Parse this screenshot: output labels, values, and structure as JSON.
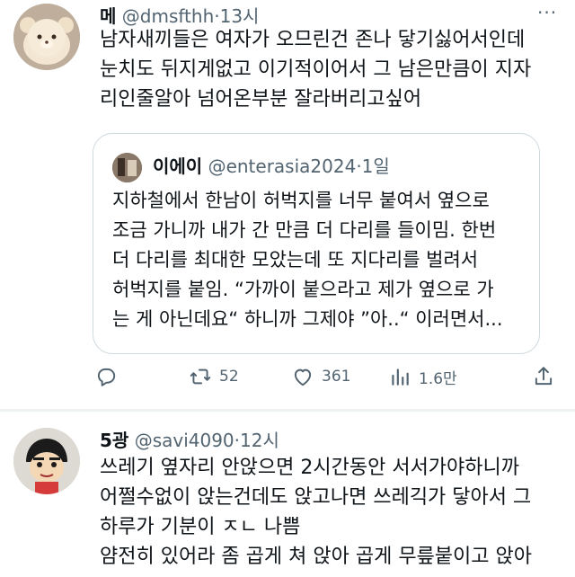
{
  "tweet1": {
    "name": "메",
    "handle": "@dmsfthh",
    "dot": "·",
    "time": "13시",
    "more": "···",
    "lines": [
      "남자새끼들은 여자가 오므린건 존나 닿기싫어서인데",
      "눈치도 뒤지게없고 이기적이어서 그 남은만큼이 지자",
      "리인줄알아 넘어온부분 잘라버리고싶어"
    ],
    "quote": {
      "name": "이에이",
      "handle": "@enterasia2024",
      "dot": "·",
      "time": "1일",
      "lines": [
        "지하철에서 한남이 허벅지를 너무 붙여서 옆으로",
        "조금 가니까 내가 간 만큼 더 다리를 들이밈. 한번",
        "더 다리를 최대한 모았는데 또 지다리를 벌려서",
        "허벅지를 붙임. “가까이 붙으라고 제가 옆으로 가",
        "는 게 아닌데요“ 하니까 그제야 ”아..“ 이러면서..."
      ]
    },
    "actions": {
      "retweets": "52",
      "likes": "361",
      "views": "1.6만"
    }
  },
  "tweet2": {
    "name": "5광",
    "handle": "@savi4090",
    "dot": "·",
    "time": "12시",
    "lines": [
      "쓰레기 옆자리 안앉으면 2시간동안 서서가야하니까",
      "어쩔수없이 앉는건데도 앉고나면 쓰레긱가 닿아서 그",
      "하루가 기분이 ㅈㄴ 나쁨",
      "얌전히 있어라 좀 곱게 쳐 앉아 곱게 무릎붙이고 앉아"
    ]
  },
  "colors": {
    "text": "#0f1419",
    "secondary": "#536471",
    "border": "#cfd9de",
    "separator": "#eff3f4"
  },
  "icons": [
    "reply-icon",
    "retweet-icon",
    "like-icon",
    "views-icon",
    "share-icon",
    "more-icon"
  ]
}
